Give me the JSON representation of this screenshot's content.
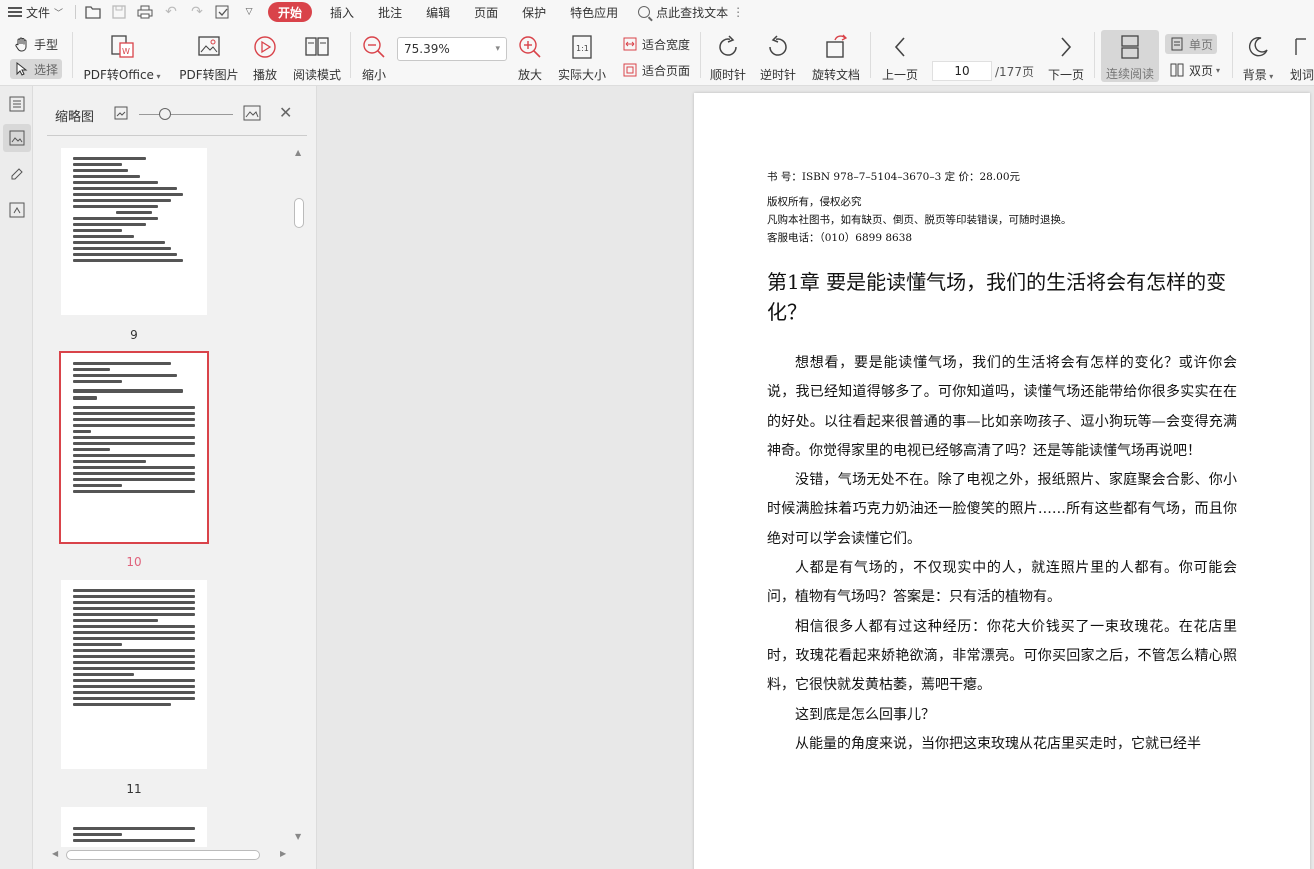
{
  "menu": {
    "file": "文件",
    "tabs": [
      "开始",
      "插入",
      "批注",
      "编辑",
      "页面",
      "保护",
      "特色应用"
    ],
    "active_tab": "开始",
    "search": "点此查找文本"
  },
  "ribbon": {
    "hand": "手型",
    "select": "选择",
    "pdf_to_office": "PDF转Office",
    "pdf_to_image": "PDF转图片",
    "play": "播放",
    "read_mode": "阅读模式",
    "zoom_out": "缩小",
    "zoom_value": "75.39%",
    "zoom_in": "放大",
    "actual_size": "实际大小",
    "fit_width": "适合宽度",
    "fit_page": "适合页面",
    "rotate_cw": "顺时针",
    "rotate_ccw": "逆时针",
    "rotate_doc": "旋转文档",
    "prev_page": "上一页",
    "page_current": "10",
    "page_total": "/177页",
    "next_page": "下一页",
    "continuous": "连续阅读",
    "single": "单页",
    "double": "双页",
    "background": "背景",
    "highlight": "划词"
  },
  "thumbnails": {
    "title": "缩略图",
    "pages": [
      {
        "num": "9"
      },
      {
        "num": "10",
        "selected": true
      },
      {
        "num": "11"
      }
    ]
  },
  "document": {
    "meta": [
      "书 号：ISBN 978–7–5104–3670–3  定 价：28.00元",
      "版权所有，侵权必究",
      "凡购本社图书，如有缺页、倒页、脱页等印装错误，可随时退换。",
      "客服电话：（010）6899 8638"
    ],
    "chapter_title": "第1章   要是能读懂气场，我们的生活将会有怎样的变化？",
    "paragraphs": [
      "想想看，要是能读懂气场，我们的生活将会有怎样的变化？或许你会说，我已经知道得够多了。可你知道吗，读懂气场还能带给你很多实实在在的好处。以往看起来很普通的事—比如亲吻孩子、逗小狗玩等—会变得充满神奇。你觉得家里的电视已经够高清了吗？还是等能读懂气场再说吧！",
      "没错，气场无处不在。除了电视之外，报纸照片、家庭聚会合影、你小时候满脸抹着巧克力奶油还一脸傻笑的照片……所有这些都有气场，而且你绝对可以学会读懂它们。",
      "人都是有气场的，不仅现实中的人，就连照片里的人都有。你可能会问，植物有气场吗？答案是：只有活的植物有。",
      "相信很多人都有过这种经历：你花大价钱买了一束玫瑰花。在花店里时，玫瑰花看起来娇艳欲滴，非常漂亮。可你买回家之后，不管怎么精心照料，它很快就发黄枯萎，蔫吧干瘪。",
      "这到底是怎么回事儿？",
      "从能量的角度来说，当你把这束玫瑰从花店里买走时，它就已经半"
    ]
  }
}
